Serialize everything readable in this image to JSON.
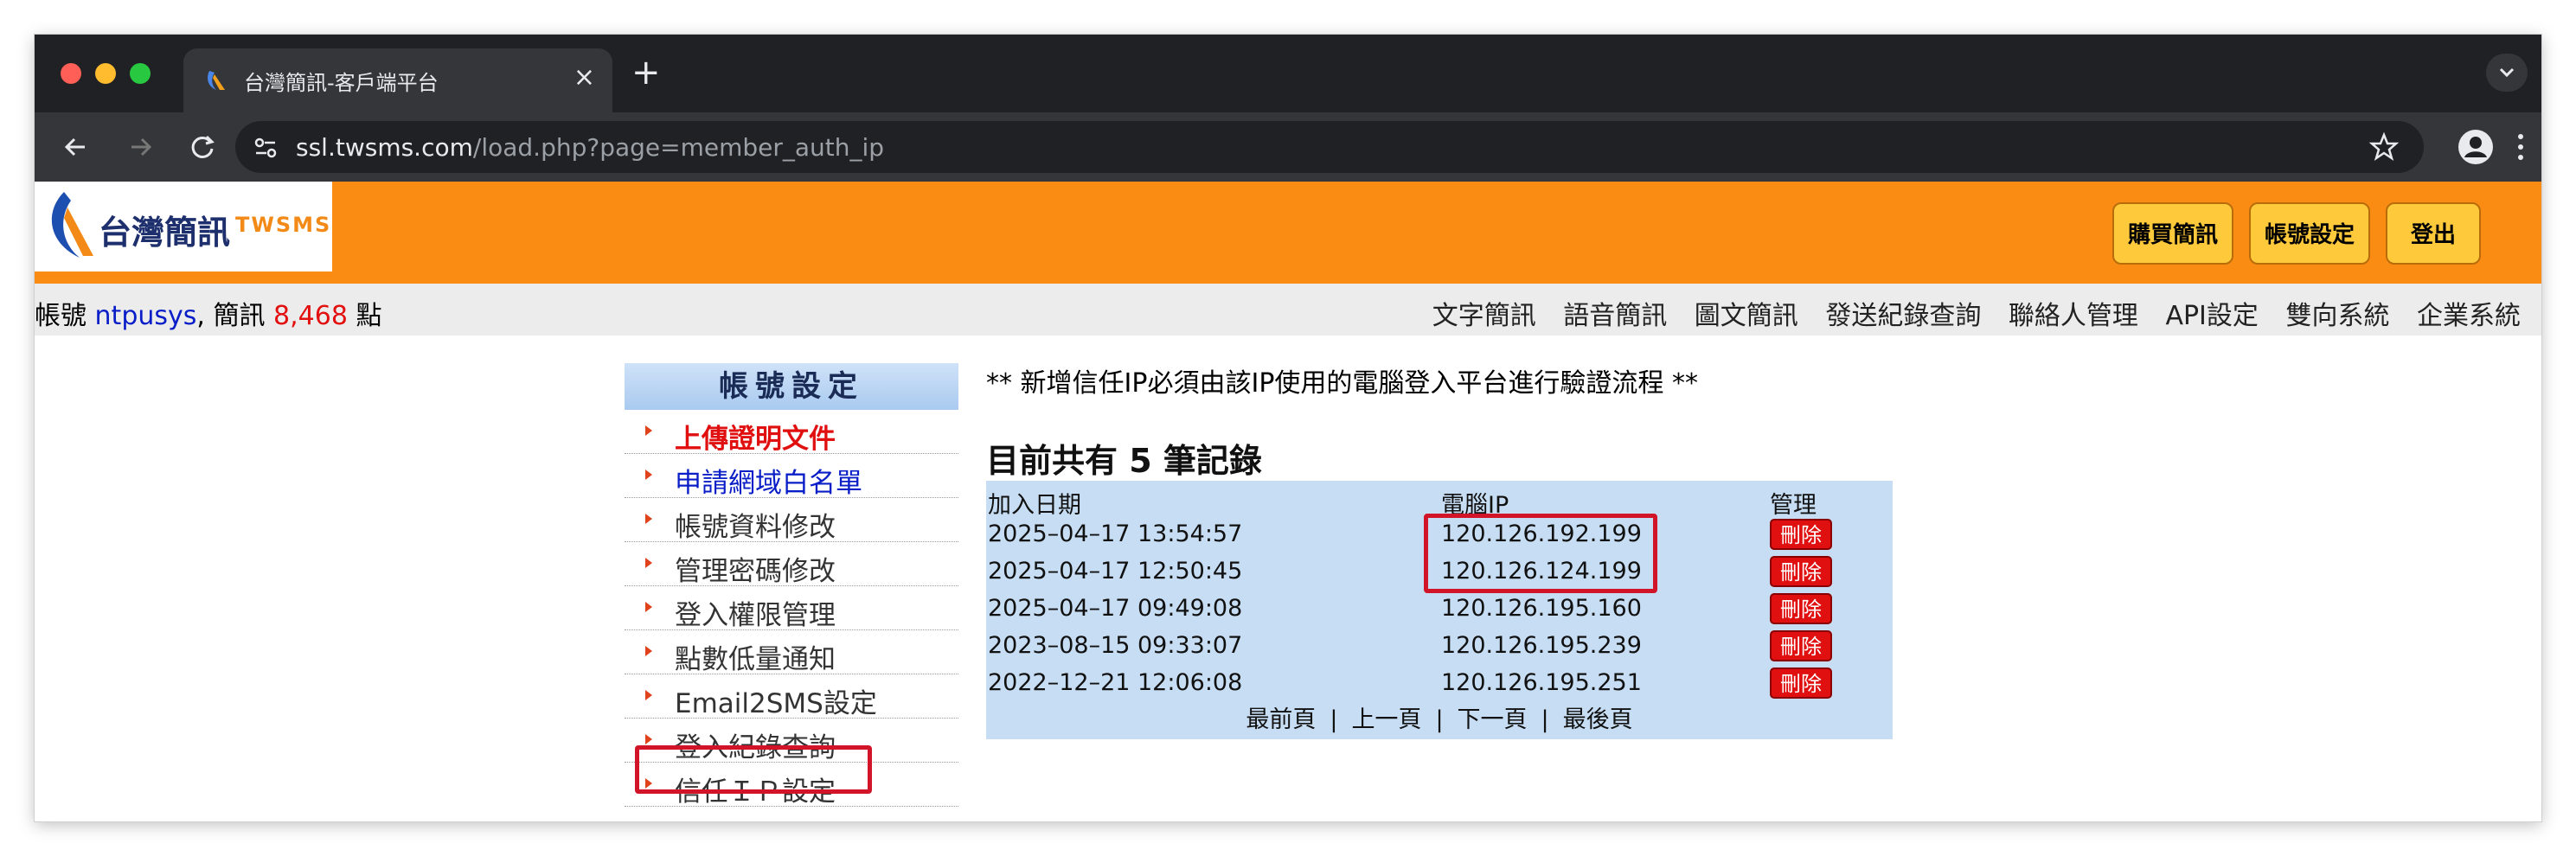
{
  "browser": {
    "tab_title": "台灣簡訊-客戶端平台",
    "tab_close": "×",
    "new_tab": "+",
    "url_host": "ssl.twsms.com",
    "url_path": "/load.php?page=member_auth_ip"
  },
  "header": {
    "logo_text": "台灣簡訊",
    "logo_brand": "TWSMS",
    "buttons": [
      "購買簡訊",
      "帳號設定",
      "登出"
    ]
  },
  "infobar": {
    "account_prefix": "帳號",
    "username": "ntpusys",
    "sms_label": ", 簡訊",
    "points": "8,468",
    "points_unit": "點",
    "nav": [
      "文字簡訊",
      "語音簡訊",
      "圖文簡訊",
      "發送紀錄查詢",
      "聯絡人管理",
      "API設定",
      "雙向系統",
      "企業系統"
    ]
  },
  "sidebar": {
    "title": "帳號設定",
    "items": [
      {
        "label": "上傳證明文件"
      },
      {
        "label": "申請網域白名單"
      },
      {
        "label": "帳號資料修改"
      },
      {
        "label": "管理密碼修改"
      },
      {
        "label": "登入權限管理"
      },
      {
        "label": "點數低量通知"
      },
      {
        "label": "Email2SMS設定"
      },
      {
        "label": "登入紀錄查詢"
      },
      {
        "label": "信任ＩＰ設定"
      }
    ]
  },
  "main": {
    "notice": "** 新增信任IP必須由該IP使用的電腦登入平台進行驗證流程 **",
    "record_count": "目前共有 5 筆記錄",
    "columns": [
      "加入日期",
      "電腦IP",
      "管理"
    ],
    "rows": [
      {
        "date": "2025–04–17 13:54:57",
        "ip": "120.126.192.199"
      },
      {
        "date": "2025–04–17 12:50:45",
        "ip": "120.126.124.199"
      },
      {
        "date": "2025–04–17 09:49:08",
        "ip": "120.126.195.160"
      },
      {
        "date": "2023–08–15 09:33:07",
        "ip": "120.126.195.239"
      },
      {
        "date": "2022–12–21 12:06:08",
        "ip": "120.126.195.251"
      }
    ],
    "delete_label": "刪除",
    "pager": [
      "最前頁",
      "|",
      "上一頁",
      "|",
      "下一頁",
      "|",
      "最後頁"
    ]
  }
}
